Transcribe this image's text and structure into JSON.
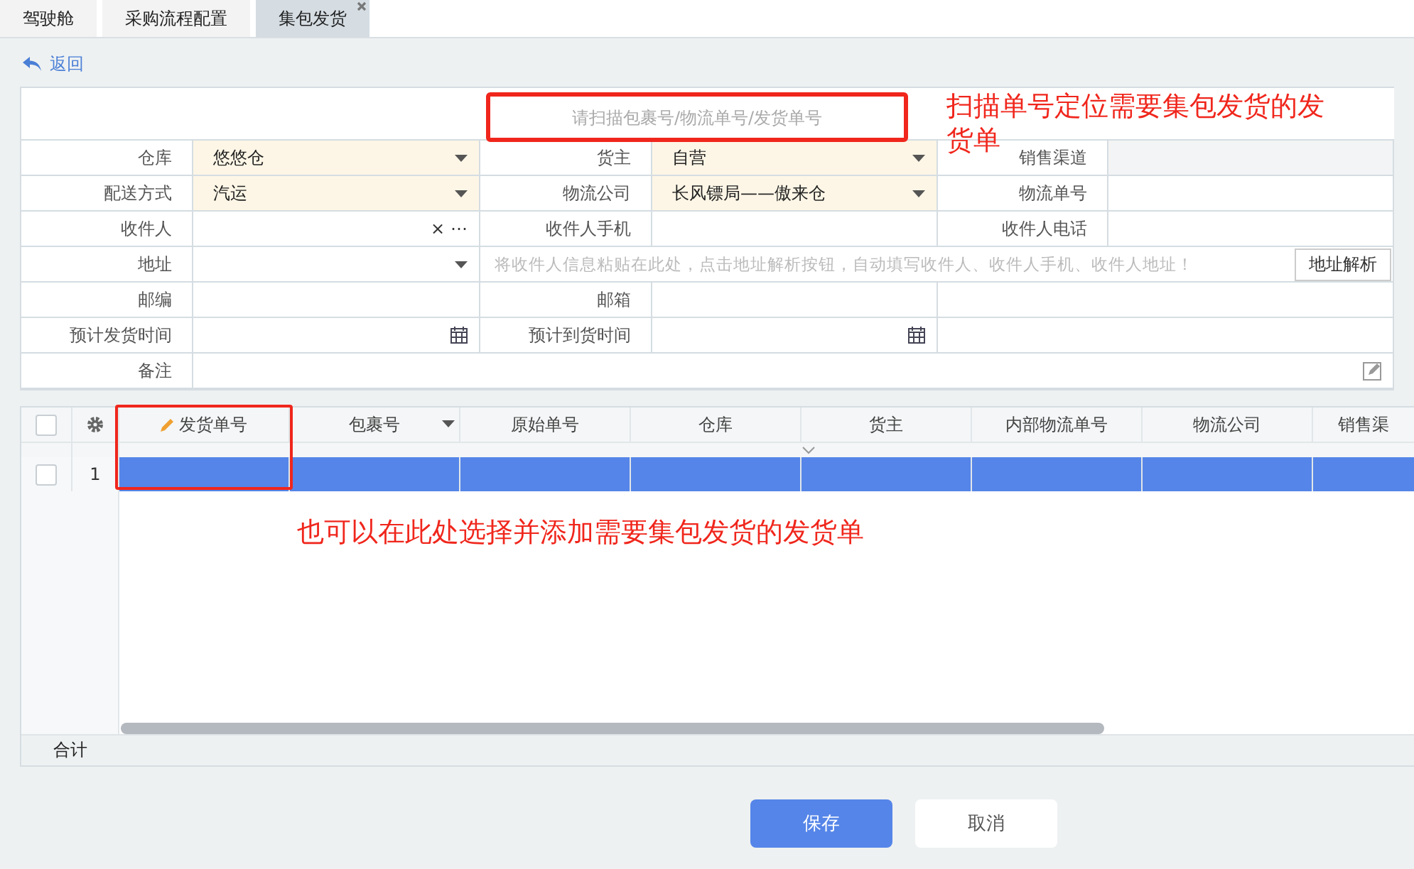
{
  "tabs": [
    {
      "label": "驾驶舱",
      "selected": false
    },
    {
      "label": "采购流程配置",
      "selected": false
    },
    {
      "label": "集包发货",
      "selected": true
    }
  ],
  "back_link": "返回",
  "scan": {
    "placeholder": "请扫描包裹号/物流单号/发货单号"
  },
  "form": {
    "rows": [
      [
        {
          "kind": "label",
          "text": "仓库"
        },
        {
          "kind": "select",
          "value": "悠悠仓",
          "required": true
        },
        {
          "kind": "label",
          "text": "货主"
        },
        {
          "kind": "select",
          "value": "自营",
          "required": true
        },
        {
          "kind": "label",
          "text": "销售渠道"
        },
        {
          "kind": "text",
          "disabled": true
        }
      ],
      [
        {
          "kind": "label",
          "text": "配送方式"
        },
        {
          "kind": "select",
          "value": "汽运",
          "required": true
        },
        {
          "kind": "label",
          "text": "物流公司"
        },
        {
          "kind": "select",
          "value": "长风镖局——傲来仓",
          "required": true
        },
        {
          "kind": "label",
          "text": "物流单号"
        },
        {
          "kind": "text",
          "disabled": false
        }
      ],
      [
        {
          "kind": "label",
          "text": "收件人"
        },
        {
          "kind": "lookup",
          "clear": "×",
          "more": "⋯"
        },
        {
          "kind": "label",
          "text": "收件人手机"
        },
        {
          "kind": "text",
          "disabled": false
        },
        {
          "kind": "label",
          "text": "收件人电话"
        },
        {
          "kind": "text",
          "disabled": false
        }
      ],
      [
        {
          "kind": "label",
          "text": "地址"
        },
        {
          "kind": "select",
          "required": false
        },
        {
          "kind": "paste",
          "placeholder": "将收件人信息粘贴在此处，点击地址解析按钮，自动填写收件人、收件人手机、收件人地址！",
          "button": "地址解析"
        }
      ],
      [
        {
          "kind": "label",
          "text": "邮编"
        },
        {
          "kind": "text",
          "disabled": false
        },
        {
          "kind": "label",
          "text": "邮箱"
        },
        {
          "kind": "text",
          "disabled": false
        },
        {
          "kind": "text",
          "disabled": false
        }
      ],
      [
        {
          "kind": "label",
          "text": "预计发货时间"
        },
        {
          "kind": "date"
        },
        {
          "kind": "label",
          "text": "预计到货时间"
        },
        {
          "kind": "date"
        },
        {
          "kind": "text",
          "disabled": false
        }
      ],
      [
        {
          "kind": "label",
          "text": "备注"
        },
        {
          "kind": "note"
        }
      ]
    ]
  },
  "grid": {
    "columns": [
      {
        "label": "发货单号",
        "editable": true,
        "menu": false
      },
      {
        "label": "包裹号",
        "editable": false,
        "menu": true
      },
      {
        "label": "原始单号",
        "editable": false,
        "menu": false
      },
      {
        "label": "仓库",
        "editable": false,
        "menu": false
      },
      {
        "label": "货主",
        "editable": false,
        "menu": false
      },
      {
        "label": "内部物流单号",
        "editable": false,
        "menu": false
      },
      {
        "label": "物流公司",
        "editable": false,
        "menu": false
      },
      {
        "label": "销售渠",
        "editable": false,
        "menu": false
      }
    ],
    "header_checked": false,
    "rows": [
      {
        "number": "1",
        "selected": true,
        "checked": false
      }
    ],
    "footer": "合计"
  },
  "annotations": [
    {
      "lines": [
        "扫描单号定位需要集包发货的发",
        "货单"
      ]
    },
    {
      "lines": [
        "也可以在此处选择并添加需要集包发货的发货单"
      ]
    }
  ],
  "buttons": [
    {
      "label": "保存",
      "primary": true
    },
    {
      "label": "取消",
      "primary": false
    }
  ]
}
